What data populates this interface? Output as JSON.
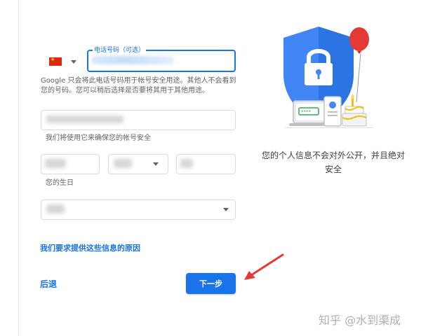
{
  "phone": {
    "country_flag": "china-flag-icon",
    "label": "电话号码（可选）"
  },
  "phone_help_text": "Google 只会将此电话号码用于帐号安全用途。其他人不会看到您的号码。您可以稍后选择是否要将其用于其他用途。",
  "recovery_email_caption": "我们将使用它来确保您的帐号安全",
  "birthday_caption": "您的生日",
  "why_link": "我们要求提供这些信息的原因",
  "back_button": "后退",
  "next_button": "下一步",
  "privacy_text": "您的个人信息不会对外公开，并且绝对安全",
  "watermark": "知乎 @水到渠成",
  "colors": {
    "accent": "#1a73e8",
    "shield": "#4285f4",
    "balloon": "#e53935",
    "annotation_arrow": "#e53935"
  }
}
